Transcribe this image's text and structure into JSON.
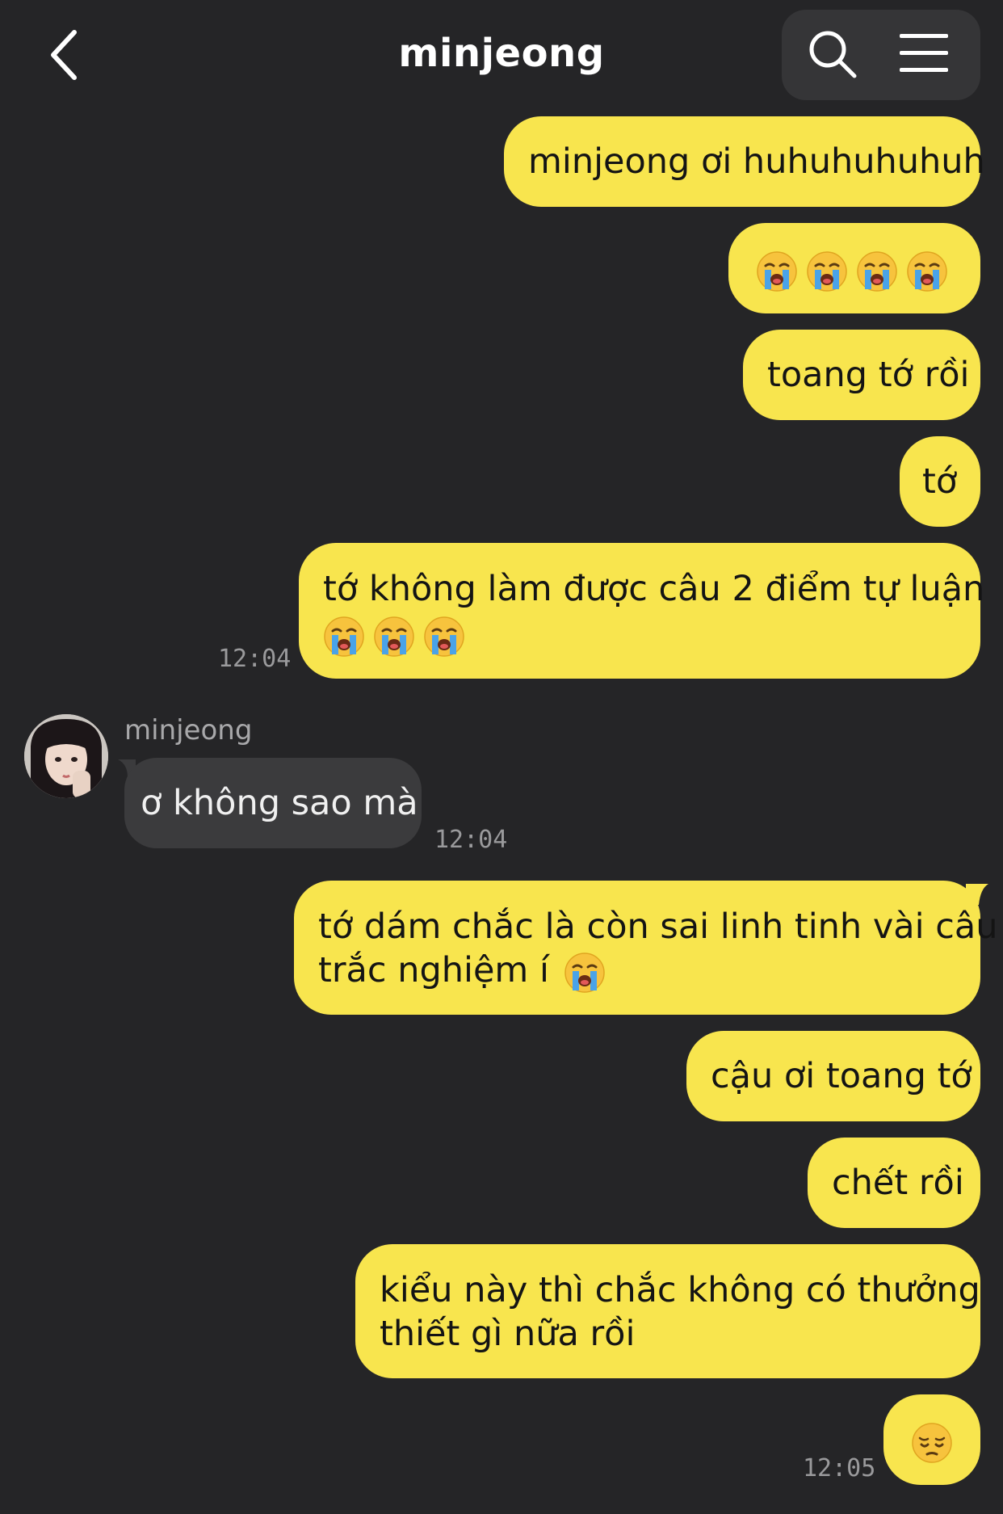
{
  "header": {
    "title": "minjeong",
    "back_icon": "chevron-left-icon",
    "search_icon": "search-icon",
    "menu_icon": "hamburger-menu-icon"
  },
  "colors": {
    "background": "#252527",
    "outgoing_bubble": "#f8e54e",
    "incoming_bubble": "#3b3b3d"
  },
  "contact": {
    "name": "minjeong",
    "avatar": "avatar-photo"
  },
  "messages": [
    {
      "from": "me",
      "text": "minjeong ơi huhuhuhuhuh"
    },
    {
      "from": "me",
      "text": "",
      "emoji": [
        "loudly-crying-face",
        "loudly-crying-face",
        "loudly-crying-face",
        "loudly-crying-face"
      ]
    },
    {
      "from": "me",
      "text": "toang tớ rồi"
    },
    {
      "from": "me",
      "text": "tớ"
    },
    {
      "from": "me",
      "text": "tớ không làm được câu 2 điểm tự luận",
      "emoji": [
        "loudly-crying-face",
        "loudly-crying-face",
        "loudly-crying-face"
      ],
      "time": "12:04"
    },
    {
      "from": "them",
      "text": "ơ không sao mà",
      "time": "12:04"
    },
    {
      "from": "me",
      "lines": [
        "tớ dám chắc là còn sai linh tinh vài câu",
        "trắc nghiệm í"
      ],
      "emoji": [
        "loudly-crying-face"
      ]
    },
    {
      "from": "me",
      "text": "cậu ơi toang tớ"
    },
    {
      "from": "me",
      "text": "chết rồi"
    },
    {
      "from": "me",
      "lines": [
        "kiểu này thì chắc không có thưởng",
        "thiết gì nữa rồi"
      ]
    },
    {
      "from": "me",
      "text": "",
      "emoji": [
        "pensive-face"
      ],
      "time": "12:05"
    }
  ]
}
